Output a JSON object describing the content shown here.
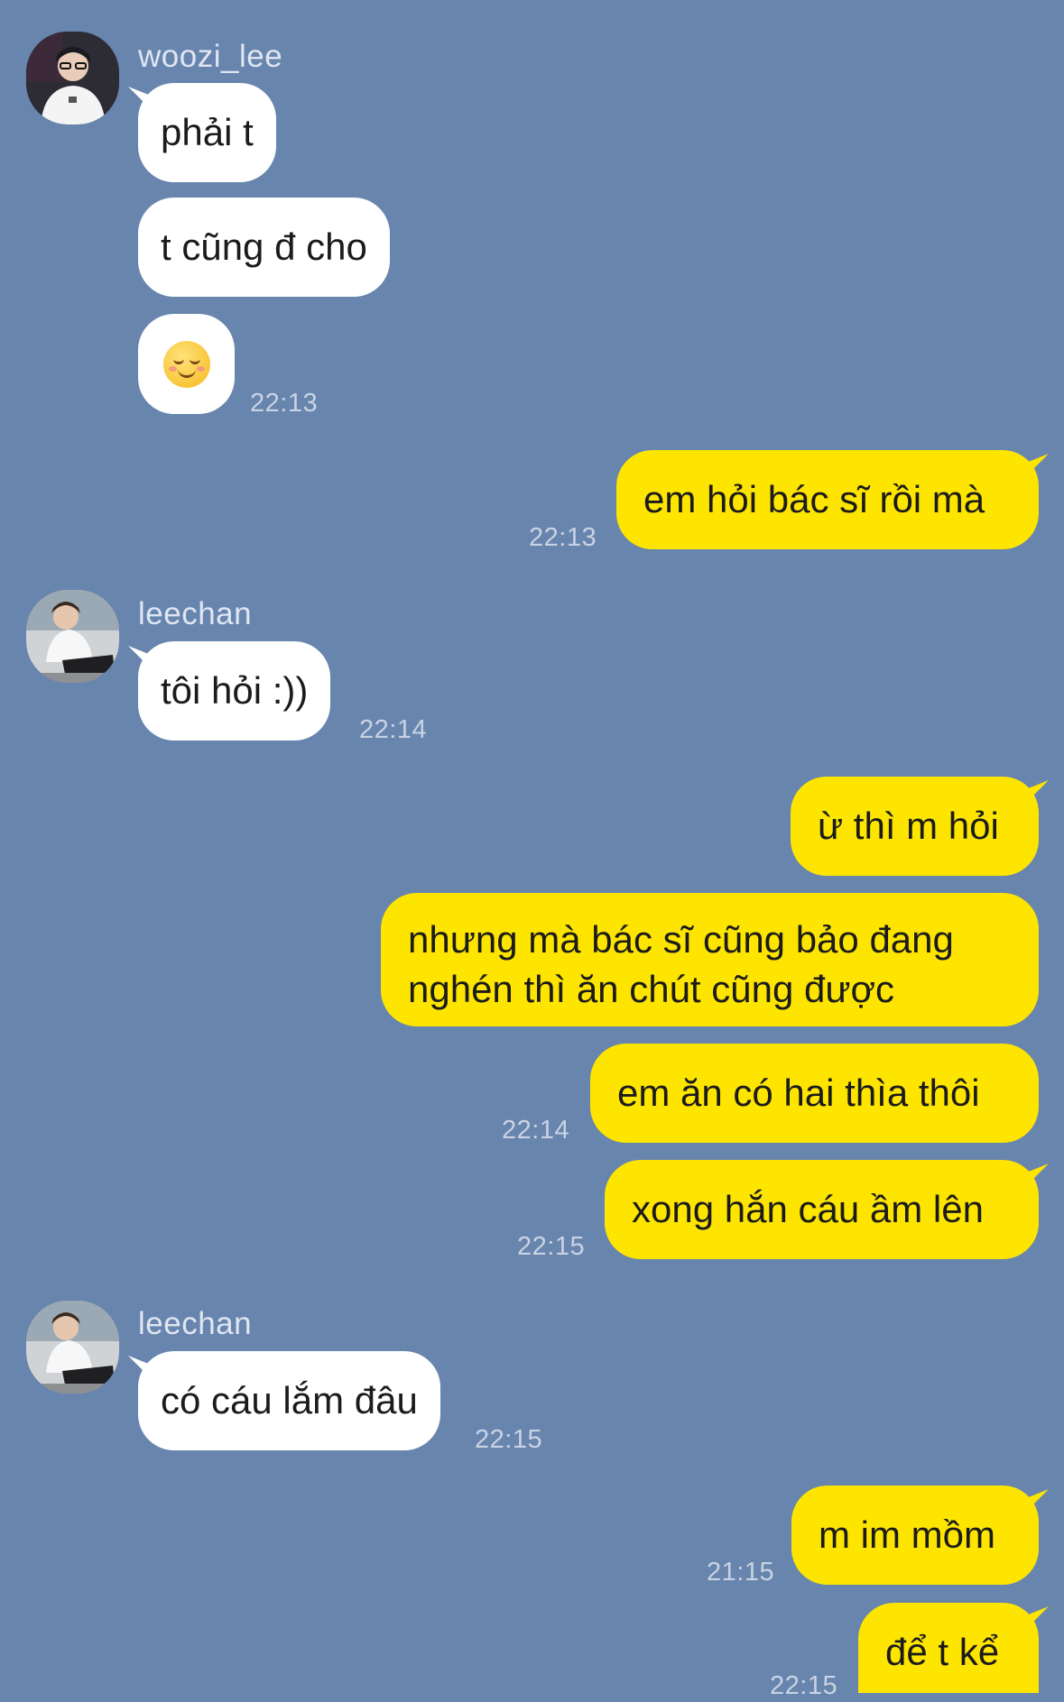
{
  "colors": {
    "background": "#6885ae",
    "incoming_bubble": "#ffffff",
    "outgoing_bubble": "#fee500",
    "timestamp": "#c9d3e3"
  },
  "messages": {
    "g1": {
      "sender": "woozi_lee",
      "m1": "phải t",
      "m2": "t cũng đ cho",
      "emoji": "smiling-face-emoji",
      "time": "22:13"
    },
    "o1": {
      "text": "em hỏi bác sĩ rồi mà",
      "time": "22:13"
    },
    "g2": {
      "sender": "leechan",
      "m1": "tôi hỏi :))",
      "time": "22:14"
    },
    "o2": {
      "m1": "ừ thì m hỏi",
      "m2": "nhưng mà bác sĩ cũng bảo đang nghén thì ăn chút cũng được",
      "m3": "em ăn có hai thìa thôi",
      "t3": "22:14",
      "m4": "xong hắn cáu ầm lên",
      "t4": "22:15"
    },
    "g3": {
      "sender": "leechan",
      "m1": "có cáu lắm đâu",
      "time": "22:15"
    },
    "o3": {
      "m1": "m im mồm",
      "t1": "21:15",
      "m2": "để t kể",
      "t2": "22:15"
    }
  }
}
